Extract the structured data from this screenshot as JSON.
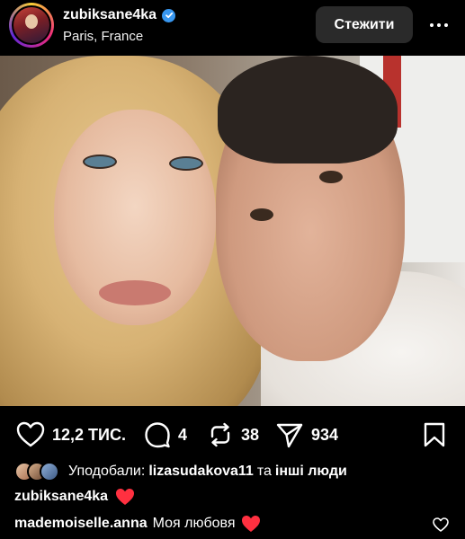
{
  "header": {
    "username": "zubiksane4ka",
    "location": "Paris, France",
    "follow_label": "Стежити"
  },
  "actions": {
    "likes_count": "12,2 ТИС.",
    "comments_count": "4",
    "reposts_count": "38",
    "shares_count": "934"
  },
  "liked_by": {
    "prefix": "Уподобали:",
    "user": "lizasudakova11",
    "connector": "та",
    "others": "інші люди"
  },
  "caption": {
    "username": "zubiksane4ka",
    "emoji": "❤️"
  },
  "comment": {
    "username": "mademoiselle.anna",
    "text": "Моя любовя",
    "emoji": "❤️"
  },
  "colors": {
    "accent_verified": "#3897f0",
    "heart_red": "#ff3040"
  }
}
